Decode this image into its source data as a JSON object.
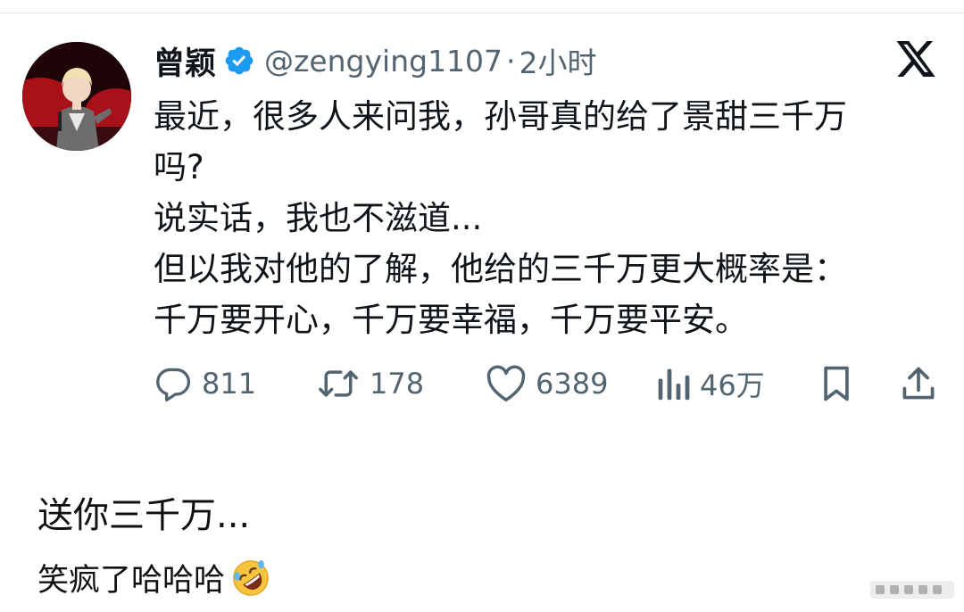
{
  "tweet": {
    "display_name": "曾颖",
    "handle": "@zengying1107",
    "separator": "·",
    "time": "2小时",
    "lines": [
      "最近，很多人来问我，孙哥真的给了景甜三千万",
      "吗?",
      "说实话，我也不滋道...",
      "但以我对他的了解，他给的三千万更大概率是：",
      "千万要开心，千万要幸福，千万要平安。"
    ],
    "stats": {
      "replies": "811",
      "reposts": "178",
      "likes": "6389",
      "views": "46万"
    }
  },
  "icons": {
    "verified": "verified-badge-icon",
    "platform": "x-logo-icon",
    "reply": "reply-icon",
    "repost": "repost-icon",
    "like": "heart-icon",
    "views": "views-icon",
    "bookmark": "bookmark-icon",
    "share": "share-icon",
    "emoji": "rolling-on-floor-laughing-emoji"
  },
  "captions": {
    "line1": "送你三千万...",
    "line2": "笑疯了哈哈哈"
  },
  "colors": {
    "verified": "#1d9bf0",
    "secondary_text": "#536471",
    "primary_text": "#0f1419"
  }
}
